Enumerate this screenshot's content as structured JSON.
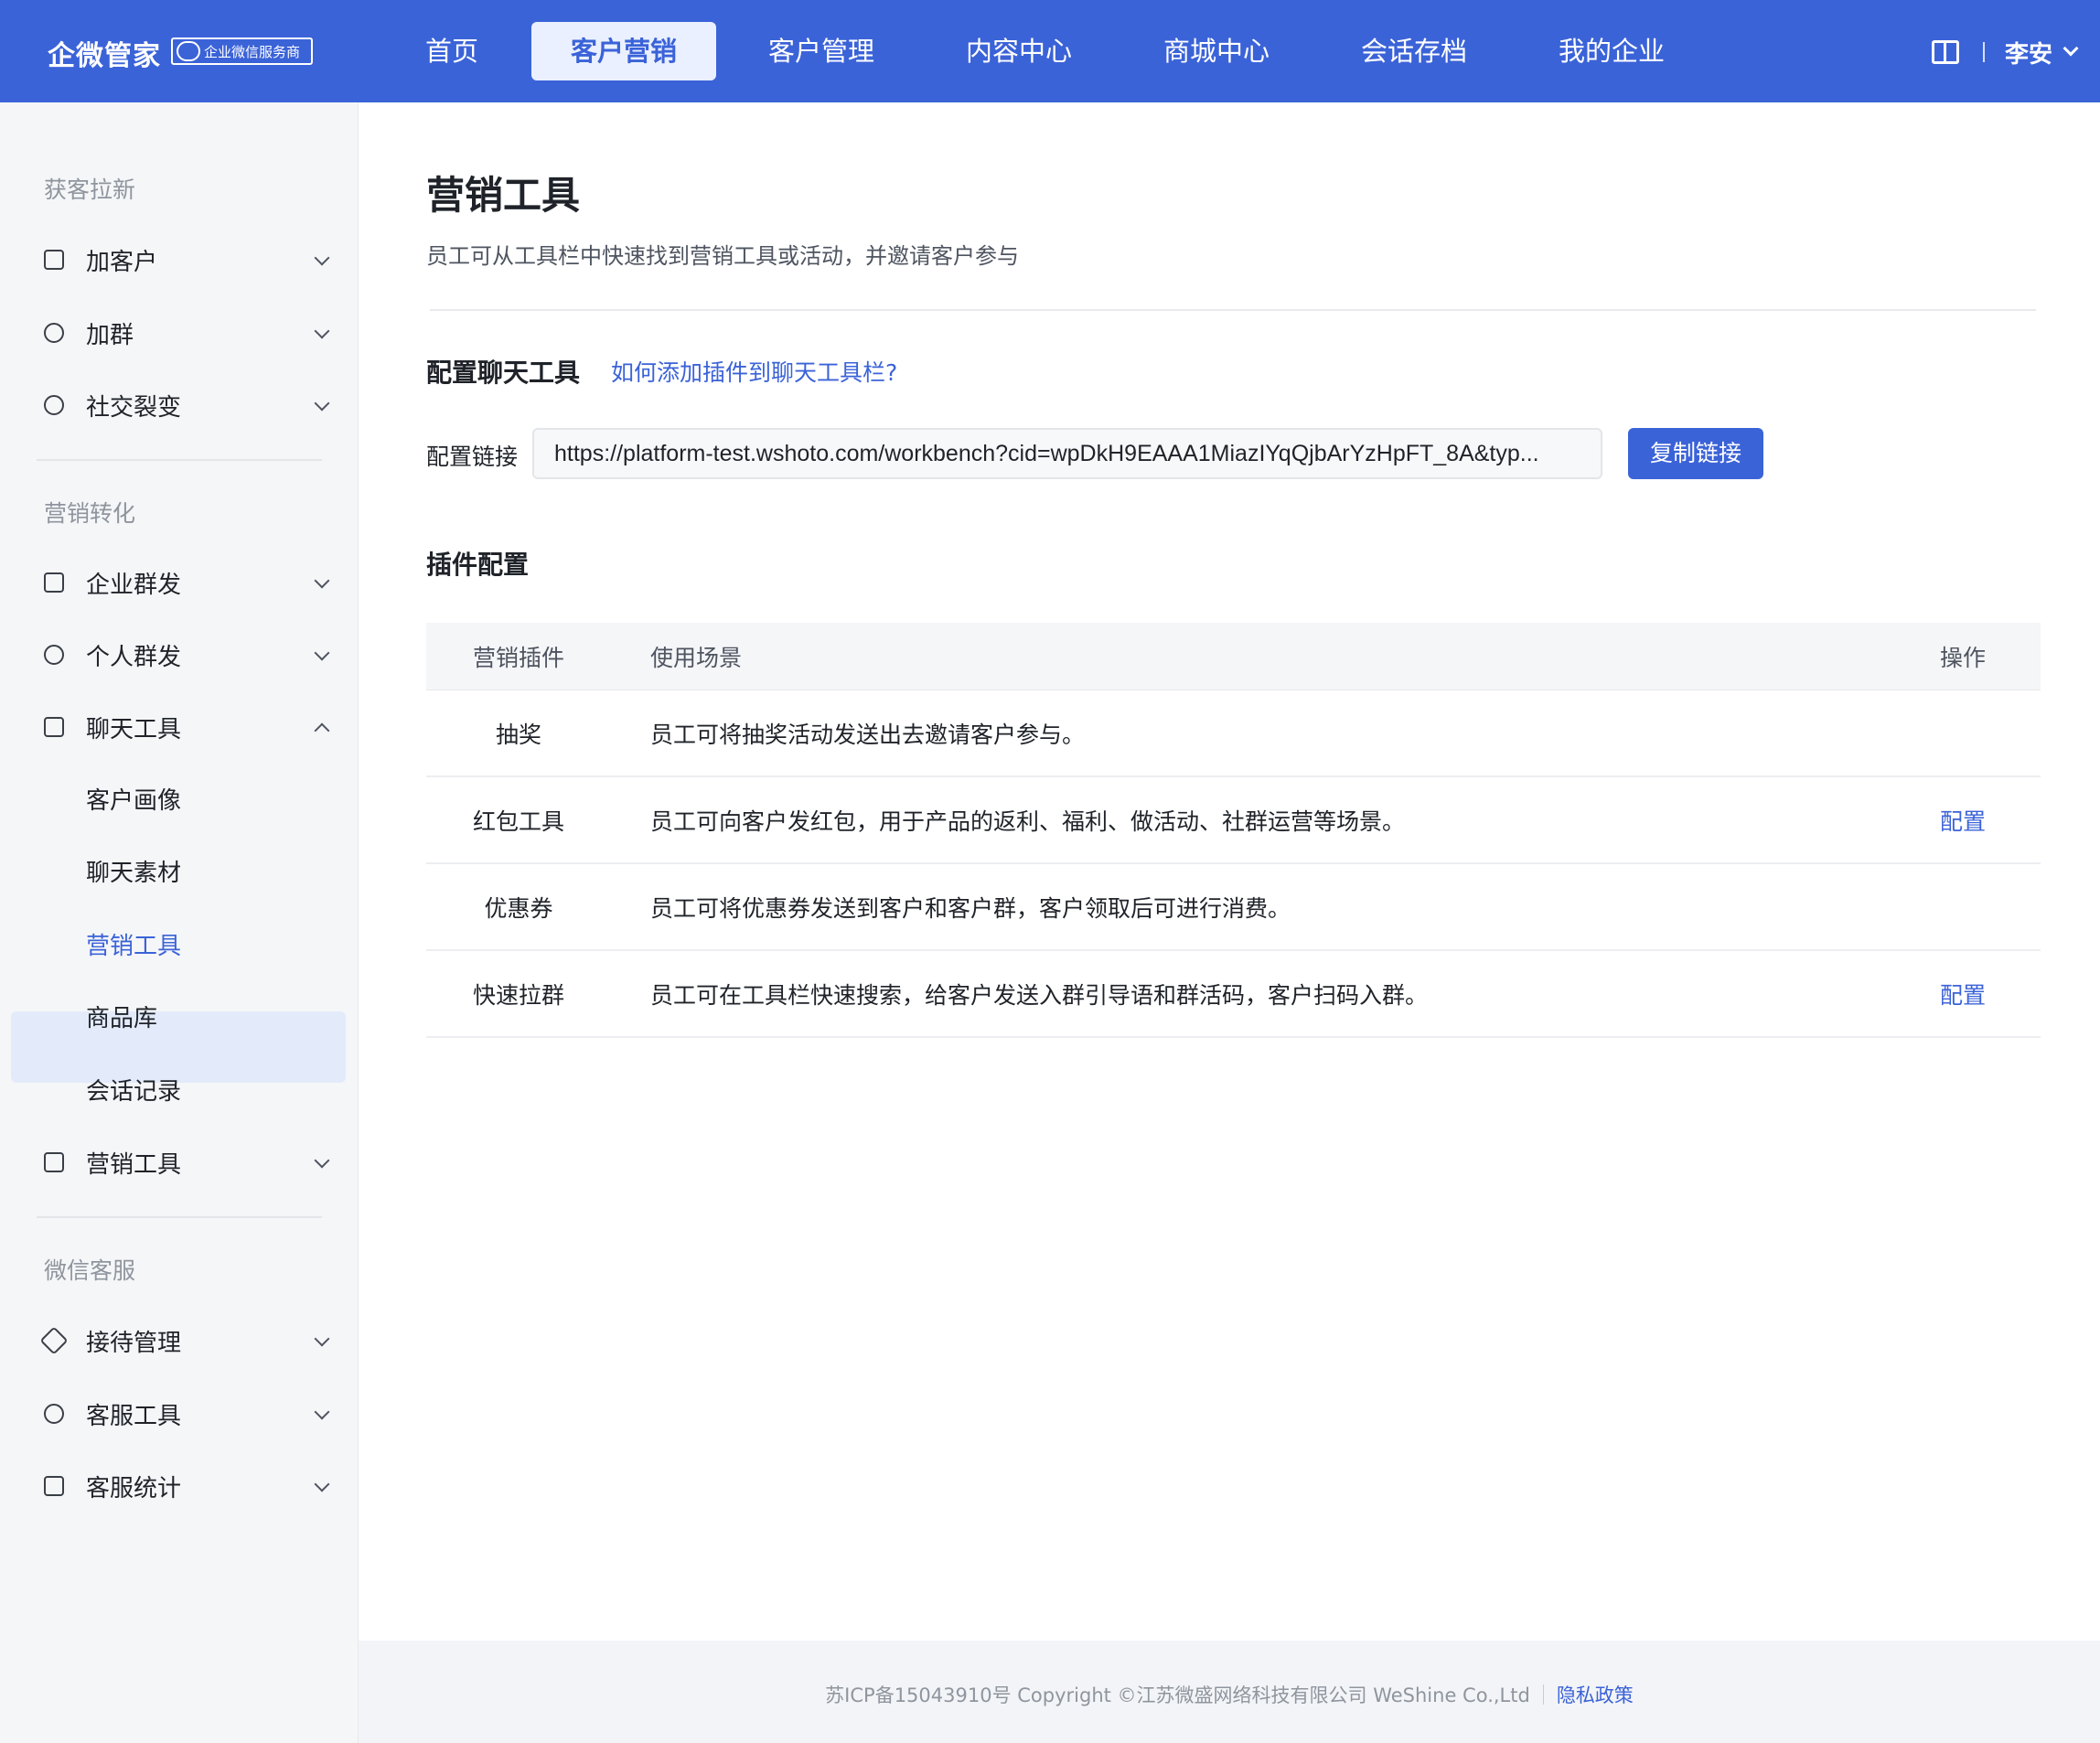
{
  "header": {
    "brand": "企微管家",
    "badge": "企业微信服务商",
    "nav": [
      "首页",
      "客户营销",
      "客户管理",
      "内容中心",
      "商城中心",
      "会话存档",
      "我的企业"
    ],
    "active_nav": "客户营销",
    "user": "李安"
  },
  "sidebar": {
    "groups": [
      "获客拉新",
      "营销转化",
      "微信客服"
    ],
    "items": [
      {
        "label": "加客户",
        "icon": "apps-icon"
      },
      {
        "label": "加群",
        "icon": "user-add-icon"
      },
      {
        "label": "社交裂变",
        "icon": "share-icon"
      },
      {
        "label": "企业群发",
        "icon": "mass-send-icon"
      },
      {
        "label": "个人群发",
        "icon": "person-send-icon"
      },
      {
        "label": "聊天工具",
        "icon": "chat-icon"
      },
      {
        "label": "营销工具",
        "icon": "chart-icon"
      },
      {
        "label": "接待管理",
        "icon": "diamond-icon"
      },
      {
        "label": "客服工具",
        "icon": "headset-icon"
      },
      {
        "label": "客服统计",
        "icon": "bar-chart-icon"
      }
    ],
    "subitems": [
      "客户画像",
      "聊天素材",
      "营销工具",
      "商品库",
      "会话记录"
    ],
    "active_sub": "营销工具"
  },
  "main": {
    "title": "营销工具",
    "description": "员工可从工具栏中快速找到营销工具或活动，并邀请客户参与",
    "section1": "配置聊天工具",
    "help_link": "如何添加插件到聊天工具栏?",
    "config_label": "配置链接",
    "config_url": "https://platform-test.wshoto.com/workbench?cid=wpDkH9EAAA1MiazIYqQjbArYzHpFT_8A&typ...",
    "copy_button": "复制链接",
    "section2": "插件配置",
    "table": {
      "headers": [
        "营销插件",
        "使用场景",
        "操作"
      ],
      "rows": [
        {
          "name": "抽奖",
          "desc": "员工可将抽奖活动发送出去邀请客户参与。",
          "action": ""
        },
        {
          "name": "红包工具",
          "desc": "员工可向客户发红包，用于产品的返利、福利、做活动、社群运营等场景。",
          "action": "配置"
        },
        {
          "name": "优惠券",
          "desc": "员工可将优惠券发送到客户和客户群，客户领取后可进行消费。",
          "action": ""
        },
        {
          "name": "快速拉群",
          "desc": "员工可在工具栏快速搜索，给客户发送入群引导语和群活码，客户扫码入群。",
          "action": "配置"
        }
      ]
    }
  },
  "footer": {
    "copyright": "苏ICP备15043910号 Copyright ©江苏微盛网络科技有限公司 WeShine Co.,Ltd",
    "privacy": "隐私政策"
  },
  "colors": {
    "primary": "#3b63d8",
    "sidebar_bg": "#f5f6f8",
    "active_bg": "#e3ebfb"
  }
}
